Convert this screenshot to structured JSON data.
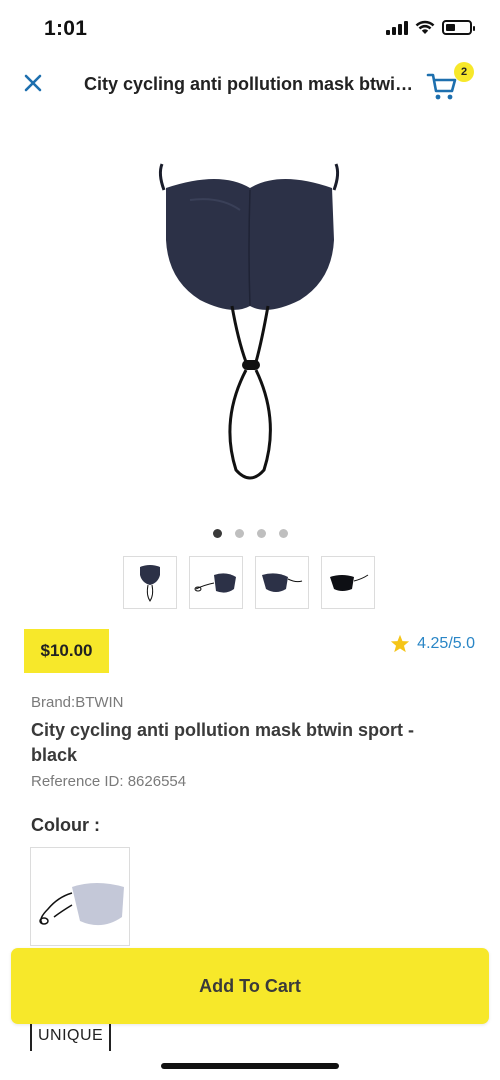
{
  "status_bar": {
    "time": "1:01",
    "icons": [
      "signal-icon",
      "wifi-icon",
      "battery-icon"
    ]
  },
  "header": {
    "close_icon": "close-icon",
    "title": "City cycling anti pollution mask btwin sport - black",
    "cart_icon": "cart-icon",
    "cart_count": "2"
  },
  "gallery": {
    "dot_count": 4,
    "active_dot": 0,
    "thumbnails": [
      "front",
      "side-with-cord",
      "angled",
      "side-dark"
    ]
  },
  "price": "$10.00",
  "rating": {
    "icon": "star-icon",
    "text": "4.25/5.0"
  },
  "brand": "Brand:BTWIN",
  "product_name": "City cycling anti pollution mask btwin sport - black",
  "reference": "Reference ID: 8626554",
  "colour_label": "Colour :",
  "size_option": "UNIQUE",
  "add_to_cart_label": "Add To Cart",
  "colors": {
    "accent_yellow": "#f7e82a",
    "link_blue": "#2a86c6",
    "icon_blue": "#1d6fae",
    "mask_navy": "#2c3147"
  }
}
